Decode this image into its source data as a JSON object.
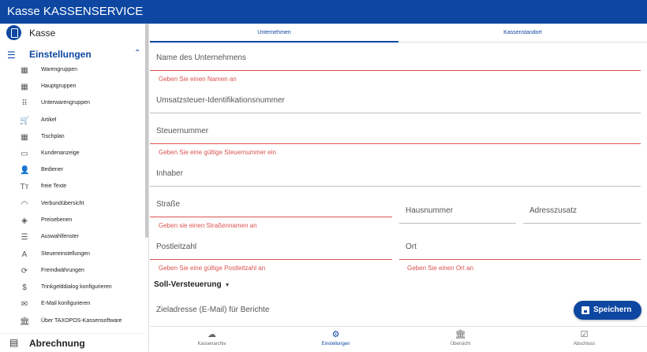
{
  "app_title": "Kasse KASSENSERVICE",
  "sidebar": {
    "kasse_label": "Kasse",
    "einstellungen_label": "Einstellungen",
    "items": [
      {
        "label": "Warengruppen",
        "icon": "grid-icon",
        "glyph": "▦"
      },
      {
        "label": "Hauptgruppen",
        "icon": "grid-icon",
        "glyph": "▦"
      },
      {
        "label": "Unterwarengruppen",
        "icon": "dotted-grid-icon",
        "glyph": "⠿"
      },
      {
        "label": "Artikel",
        "icon": "cart-icon",
        "glyph": "🛒"
      },
      {
        "label": "Tischplan",
        "icon": "table-grid-icon",
        "glyph": "▦"
      },
      {
        "label": "Kundenanzeige",
        "icon": "monitor-icon",
        "glyph": "▭"
      },
      {
        "label": "Bediener",
        "icon": "person-icon",
        "glyph": "👤"
      },
      {
        "label": "freie Texte",
        "icon": "text-size-icon",
        "glyph": "Tт"
      },
      {
        "label": "Verbundübersicht",
        "icon": "wifi-icon",
        "glyph": "◠"
      },
      {
        "label": "Preisebenen",
        "icon": "layers-icon",
        "glyph": "◈"
      },
      {
        "label": "Auswahlfenster",
        "icon": "menu-lines-icon",
        "glyph": "☰"
      },
      {
        "label": "Steuereinstellungen",
        "icon": "font-icon",
        "glyph": "A"
      },
      {
        "label": "Fremdwährungen",
        "icon": "currency-exchange-icon",
        "glyph": "⟳"
      },
      {
        "label": "Trinkgelddialog konfigurieren",
        "icon": "dollar-icon",
        "glyph": "$"
      },
      {
        "label": "E-Mail konfigurieren",
        "icon": "mail-icon",
        "glyph": "✉"
      },
      {
        "label": "Über TAXOPOS-Kassensoftware",
        "icon": "bank-icon",
        "glyph": "🏛"
      }
    ],
    "abrechnung_label": "Abrechnung"
  },
  "tabs": {
    "unternehmen": "Unternehmen",
    "kassenstandort": "Kassenstandort"
  },
  "form": {
    "name_label": "Name des Unternehmens",
    "name_error": "Geben Sie einen Namen an",
    "ust_label": "Umsatzsteuer-Identifikationsnummer",
    "steuer_label": "Steuernummer",
    "steuer_error": "Geben Sie eine gültige Steuernummer ein",
    "inhaber_label": "Inhaber",
    "strasse_label": "Straße",
    "strasse_error": "Geben sie einen Straßennamen an",
    "hausnummer_label": "Hausnummer",
    "adresszusatz_label": "Adresszusatz",
    "plz_label": "Postleitzahl",
    "plz_error": "Geben Sie eine gültige Postleitzahl an",
    "ort_label": "Ort",
    "ort_error": "Geben Sie einen Ort an",
    "soll_label": "Soll-Versteuerung",
    "ziel_label": "Zieladresse (E-Mail) für Berichte"
  },
  "save_label": "Speichern",
  "bottom_nav": [
    {
      "label": "Kassenarchiv",
      "icon": "cloud-icon",
      "glyph": "☁"
    },
    {
      "label": "Einstellungen",
      "icon": "gear-icon",
      "glyph": "⚙"
    },
    {
      "label": "Übersicht",
      "icon": "bank-icon",
      "glyph": "🏛"
    },
    {
      "label": "Abschluss",
      "icon": "checkbox-icon",
      "glyph": "☑"
    }
  ],
  "colors": {
    "primary": "#0d47a1",
    "error": "#d9534f"
  }
}
